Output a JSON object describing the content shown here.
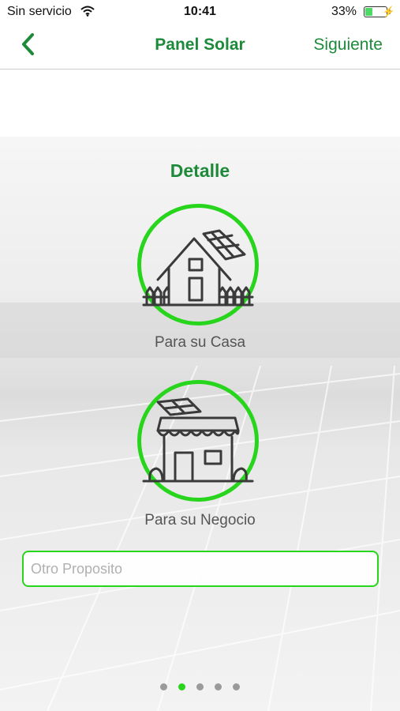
{
  "status_bar": {
    "carrier": "Sin servicio",
    "time": "10:41",
    "battery_percent": "33%",
    "battery_level": 0.33,
    "icons": [
      "wifi-icon",
      "battery-icon",
      "charging-bolt-icon"
    ]
  },
  "nav": {
    "back_icon": "chevron-left-icon",
    "title": "Panel Solar",
    "next_label": "Siguiente"
  },
  "section": {
    "title": "Detalle"
  },
  "options": [
    {
      "label": "Para su Casa",
      "icon": "house-solar-icon"
    },
    {
      "label": "Para su Negocio",
      "icon": "shop-solar-icon"
    }
  ],
  "other_purpose": {
    "placeholder": "Otro Proposito",
    "value": ""
  },
  "pager": {
    "total": 5,
    "active_index": 1
  },
  "colors": {
    "accent": "#1d8a3a",
    "ring": "#27d61c",
    "dot_inactive": "#9a9a9a"
  }
}
